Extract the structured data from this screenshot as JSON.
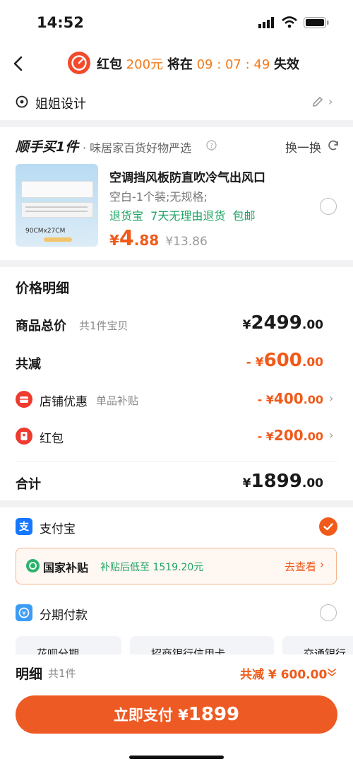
{
  "status_bar": {
    "time": "14:52"
  },
  "header": {
    "title_prefix": "红包",
    "amount": "200元",
    "middle": "将在",
    "countdown": "09 : 07 : 49",
    "suffix": "失效"
  },
  "address": {
    "name": "姐姐设计"
  },
  "promo": {
    "brand": "顺手买1件",
    "subtitle": "· 味居家百货好物严选",
    "switch_label": "换一换",
    "product": {
      "title": "空调挡风板防直吹冷气出风口",
      "spec": "空白-1个装;无规格;",
      "service": "退货宝  7天无理由退货  包邮",
      "price_symbol": "¥",
      "price_int": "4",
      "price_dec": ".88",
      "original_price": "¥13.86",
      "image_label": "90CMx27CM"
    }
  },
  "price_detail": {
    "section_title": "价格明细",
    "total_label": "商品总价",
    "total_note": "共1件宝贝",
    "total_symbol": "¥",
    "total_int": "2499",
    "total_dec": ".00",
    "discount_label": "共减",
    "discount_prefix": "- ¥",
    "discount_int": "600",
    "discount_dec": ".00",
    "store_label": "店铺优惠",
    "store_note": "单品补贴",
    "store_prefix": "- ¥",
    "store_int": "400",
    "store_dec": ".00",
    "redpacket_label": "红包",
    "redpacket_prefix": "- ¥",
    "redpacket_int": "200",
    "redpacket_dec": ".00",
    "sum_label": "合计",
    "sum_symbol": "¥",
    "sum_int": "1899",
    "sum_dec": ".00"
  },
  "payment": {
    "alipay_label": "支付宝",
    "subsidy_label": "国家补贴",
    "subsidy_text": "补贴后低至 1519.20元",
    "subsidy_link": "去查看",
    "installment_label": "分期付款",
    "chip1": "花呗分期",
    "chip2": "招商银行信用卡",
    "chip3": "交通银行"
  },
  "footer": {
    "detail_label": "明细",
    "detail_count": "共1件",
    "discount_total": "共减 ¥ 600.00",
    "pay_prefix": "立即支付 ¥",
    "pay_amount": "1899"
  },
  "colors": {
    "accent": "#f05a1a",
    "green": "#1fa363",
    "alipay_blue": "#1677ff",
    "bg": "#f2f2f4"
  },
  "icons": [
    "back-icon",
    "timer-icon",
    "location-icon",
    "edit-icon",
    "refresh-icon",
    "help-icon",
    "store-icon",
    "redpacket-icon",
    "alipay-icon",
    "subsidy-icon",
    "installment-icon",
    "check-icon",
    "chevron-right-icon",
    "chevron-down-icon"
  ]
}
